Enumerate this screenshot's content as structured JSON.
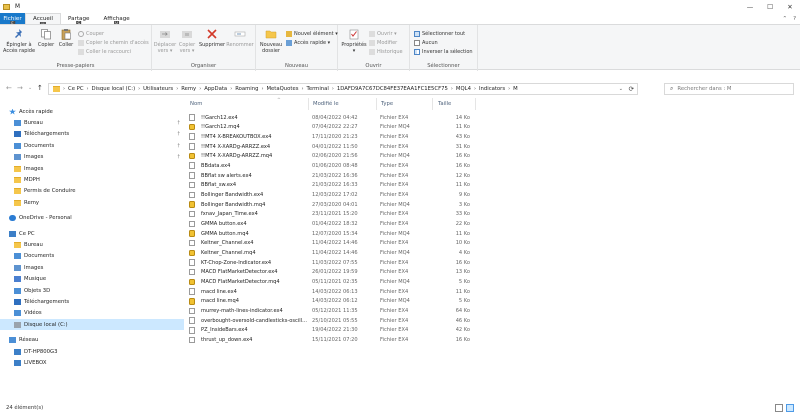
{
  "window": {
    "title": "M",
    "controls": [
      "—",
      "☐",
      "✕"
    ]
  },
  "ribbon_tabs": [
    {
      "label": "Fichier",
      "keytip": "F"
    },
    {
      "label": "Accueil",
      "keytip": "H"
    },
    {
      "label": "Partage",
      "keytip": "S"
    },
    {
      "label": "Affichage",
      "keytip": "V"
    }
  ],
  "ribbon_right": {
    "collapse": "⌃",
    "help": "?"
  },
  "ribbon": {
    "presse_papiers": {
      "title": "Presse-papiers",
      "pin": "Épingler à\nAccès rapide",
      "copy": "Copier",
      "paste": "Coller",
      "cut": "Couper",
      "copy_path": "Copier le chemin d'accès",
      "paste_shortcut": "Coller le raccourci"
    },
    "organiser": {
      "title": "Organiser",
      "move": "Déplacer\nvers ▾",
      "copy_to": "Copier\nvers ▾",
      "delete": "Supprimer",
      "rename": "Renommer"
    },
    "nouveau": {
      "title": "Nouveau",
      "new_folder": "Nouveau\ndossier",
      "new_item": "Nouvel élément ▾",
      "easy_access": "Accès rapide ▾"
    },
    "ouvrir": {
      "title": "Ouvrir",
      "properties": "Propriétés\n▾",
      "open": "Ouvrir ▾",
      "modify": "Modifier",
      "history": "Historique"
    },
    "selectionner": {
      "title": "Sélectionner",
      "select_all": "Sélectionner tout",
      "select_none": "Aucun",
      "invert": "Inverser la sélection"
    }
  },
  "address": {
    "nav": {
      "back": "←",
      "forward": "→",
      "recent": "⌄",
      "up": "↑"
    },
    "crumbs": [
      "Ce PC",
      "Disque local (C:)",
      "Utilisateurs",
      "Remy",
      "AppData",
      "Roaming",
      "MetaQuotes",
      "Terminal",
      "1DAFD9A7C67DC84FE37EAA1FC1E5CF75",
      "MQL4",
      "Indicators",
      "M"
    ],
    "dropdown": "⌄",
    "refresh": "⟳",
    "search_placeholder": "Rechercher dans : M",
    "search_icon": "⌕"
  },
  "navpane": [
    {
      "label": "Accès rapide",
      "icon": "star-icon",
      "indent": 0,
      "pinned": false,
      "selected": false
    },
    {
      "label": "Bureau",
      "icon": "desktop-icon",
      "indent": 1,
      "pinned": true,
      "selected": false
    },
    {
      "label": "Téléchargements",
      "icon": "download-icon",
      "indent": 1,
      "pinned": true,
      "selected": false
    },
    {
      "label": "Documents",
      "icon": "document-icon",
      "indent": 1,
      "pinned": true,
      "selected": false
    },
    {
      "label": "Images",
      "icon": "picture-icon",
      "indent": 1,
      "pinned": true,
      "selected": false
    },
    {
      "label": "Images",
      "icon": "folder-icon",
      "indent": 1,
      "pinned": false,
      "selected": false
    },
    {
      "label": "MDPH",
      "icon": "folder-icon",
      "indent": 1,
      "pinned": false,
      "selected": false
    },
    {
      "label": "Permis de Conduire",
      "icon": "folder-icon",
      "indent": 1,
      "pinned": false,
      "selected": false
    },
    {
      "label": "Remy",
      "icon": "folder-icon",
      "indent": 1,
      "pinned": false,
      "selected": false
    },
    {
      "label": "OneDrive - Personal",
      "icon": "cloud-icon",
      "indent": 0,
      "pinned": false,
      "selected": false,
      "gap": true
    },
    {
      "label": "Ce PC",
      "icon": "computer-icon",
      "indent": 0,
      "pinned": false,
      "selected": false,
      "gap": true
    },
    {
      "label": "Bureau",
      "icon": "folder-icon",
      "indent": 1,
      "pinned": false,
      "selected": false
    },
    {
      "label": "Documents",
      "icon": "document-icon",
      "indent": 1,
      "pinned": false,
      "selected": false
    },
    {
      "label": "Images",
      "icon": "picture-icon",
      "indent": 1,
      "pinned": false,
      "selected": false
    },
    {
      "label": "Musique",
      "icon": "music-icon",
      "indent": 1,
      "pinned": false,
      "selected": false
    },
    {
      "label": "Objets 3D",
      "icon": "cube-icon",
      "indent": 1,
      "pinned": false,
      "selected": false
    },
    {
      "label": "Téléchargements",
      "icon": "download-icon",
      "indent": 1,
      "pinned": false,
      "selected": false
    },
    {
      "label": "Vidéos",
      "icon": "video-icon",
      "indent": 1,
      "pinned": false,
      "selected": false
    },
    {
      "label": "Disque local (C:)",
      "icon": "drive-icon",
      "indent": 1,
      "pinned": false,
      "selected": true
    },
    {
      "label": "Réseau",
      "icon": "network-icon",
      "indent": 0,
      "pinned": false,
      "selected": false,
      "gap": true
    },
    {
      "label": "DT-HP800G3",
      "icon": "computer-icon",
      "indent": 1,
      "pinned": false,
      "selected": false
    },
    {
      "label": "LIVEBOX",
      "icon": "computer-icon",
      "indent": 1,
      "pinned": false,
      "selected": false
    }
  ],
  "columns": {
    "name": "Nom",
    "date": "Modifié le",
    "type": "Type",
    "size": "Taille",
    "sort_indicator": "^"
  },
  "files": [
    {
      "name": "!!Garch12.ex4",
      "date": "08/04/2022 04:42",
      "type": "Fichier EX4",
      "size": "14 Ko",
      "kind": "ex4"
    },
    {
      "name": "!!Garch12.mq4",
      "date": "07/04/2022 22:27",
      "type": "Fichier MQ4",
      "size": "11 Ko",
      "kind": "mq4"
    },
    {
      "name": "!!MT4 X-BREAKOUTBOX.ex4",
      "date": "17/11/2020 21:23",
      "type": "Fichier EX4",
      "size": "43 Ko",
      "kind": "ex4"
    },
    {
      "name": "!!MT4 X-XARDg-ARRZZ.ex4",
      "date": "04/01/2022 11:50",
      "type": "Fichier EX4",
      "size": "31 Ko",
      "kind": "ex4"
    },
    {
      "name": "!!MT4 X-XARDg-ARRZZ.mq4",
      "date": "02/06/2020 21:56",
      "type": "Fichier MQ4",
      "size": "16 Ko",
      "kind": "mq4"
    },
    {
      "name": "BBdata.ex4",
      "date": "01/06/2020 08:48",
      "type": "Fichier EX4",
      "size": "16 Ko",
      "kind": "ex4"
    },
    {
      "name": "BBflat sw alerts.ex4",
      "date": "21/03/2022 16:36",
      "type": "Fichier EX4",
      "size": "12 Ko",
      "kind": "ex4"
    },
    {
      "name": "BBflat_sw.ex4",
      "date": "21/03/2022 16:33",
      "type": "Fichier EX4",
      "size": "11 Ko",
      "kind": "ex4"
    },
    {
      "name": "Bollinger Bandwidth.ex4",
      "date": "12/03/2022 17:02",
      "type": "Fichier EX4",
      "size": "9 Ko",
      "kind": "ex4"
    },
    {
      "name": "Bollinger Bandwidth.mq4",
      "date": "27/03/2020 04:01",
      "type": "Fichier MQ4",
      "size": "3 Ko",
      "kind": "mq4"
    },
    {
      "name": "fxnav_Japan_Time.ex4",
      "date": "23/11/2021 15:20",
      "type": "Fichier EX4",
      "size": "33 Ko",
      "kind": "ex4"
    },
    {
      "name": "GMMA button.ex4",
      "date": "01/04/2022 18:32",
      "type": "Fichier EX4",
      "size": "22 Ko",
      "kind": "ex4"
    },
    {
      "name": "GMMA button.mq4",
      "date": "12/07/2020 15:34",
      "type": "Fichier MQ4",
      "size": "11 Ko",
      "kind": "mq4"
    },
    {
      "name": "Keltner_Channel.ex4",
      "date": "11/04/2022 14:46",
      "type": "Fichier EX4",
      "size": "10 Ko",
      "kind": "ex4"
    },
    {
      "name": "Keltner_Channel.mq4",
      "date": "11/04/2022 14:46",
      "type": "Fichier MQ4",
      "size": "4 Ko",
      "kind": "mq4"
    },
    {
      "name": "KT-Chop-Zone-Indicator.ex4",
      "date": "11/03/2022 07:55",
      "type": "Fichier EX4",
      "size": "16 Ko",
      "kind": "ex4"
    },
    {
      "name": "MACD FlatMarketDetector.ex4",
      "date": "26/01/2022 19:59",
      "type": "Fichier EX4",
      "size": "13 Ko",
      "kind": "ex4"
    },
    {
      "name": "MACD FlatMarketDetector.mq4",
      "date": "05/11/2021 02:35",
      "type": "Fichier MQ4",
      "size": "5 Ko",
      "kind": "mq4"
    },
    {
      "name": "macd line.ex4",
      "date": "14/03/2022 06:13",
      "type": "Fichier EX4",
      "size": "11 Ko",
      "kind": "ex4"
    },
    {
      "name": "macd line.mq4",
      "date": "14/03/2022 06:12",
      "type": "Fichier MQ4",
      "size": "5 Ko",
      "kind": "mq4"
    },
    {
      "name": "murrey-math-lines-indicator.ex4",
      "date": "05/12/2021 11:35",
      "type": "Fichier EX4",
      "size": "64 Ko",
      "kind": "ex4"
    },
    {
      "name": "overbought-oversold-candlesticks-oscill...",
      "date": "25/10/2021 05:55",
      "type": "Fichier EX4",
      "size": "46 Ko",
      "kind": "ex4"
    },
    {
      "name": "PZ_InsideBars.ex4",
      "date": "19/04/2022 21:30",
      "type": "Fichier EX4",
      "size": "42 Ko",
      "kind": "ex4"
    },
    {
      "name": "thrust_up_down.ex4",
      "date": "15/11/2021 07:20",
      "type": "Fichier EX4",
      "size": "16 Ko",
      "kind": "ex4"
    }
  ],
  "status": {
    "count": "24 élément(s)"
  }
}
